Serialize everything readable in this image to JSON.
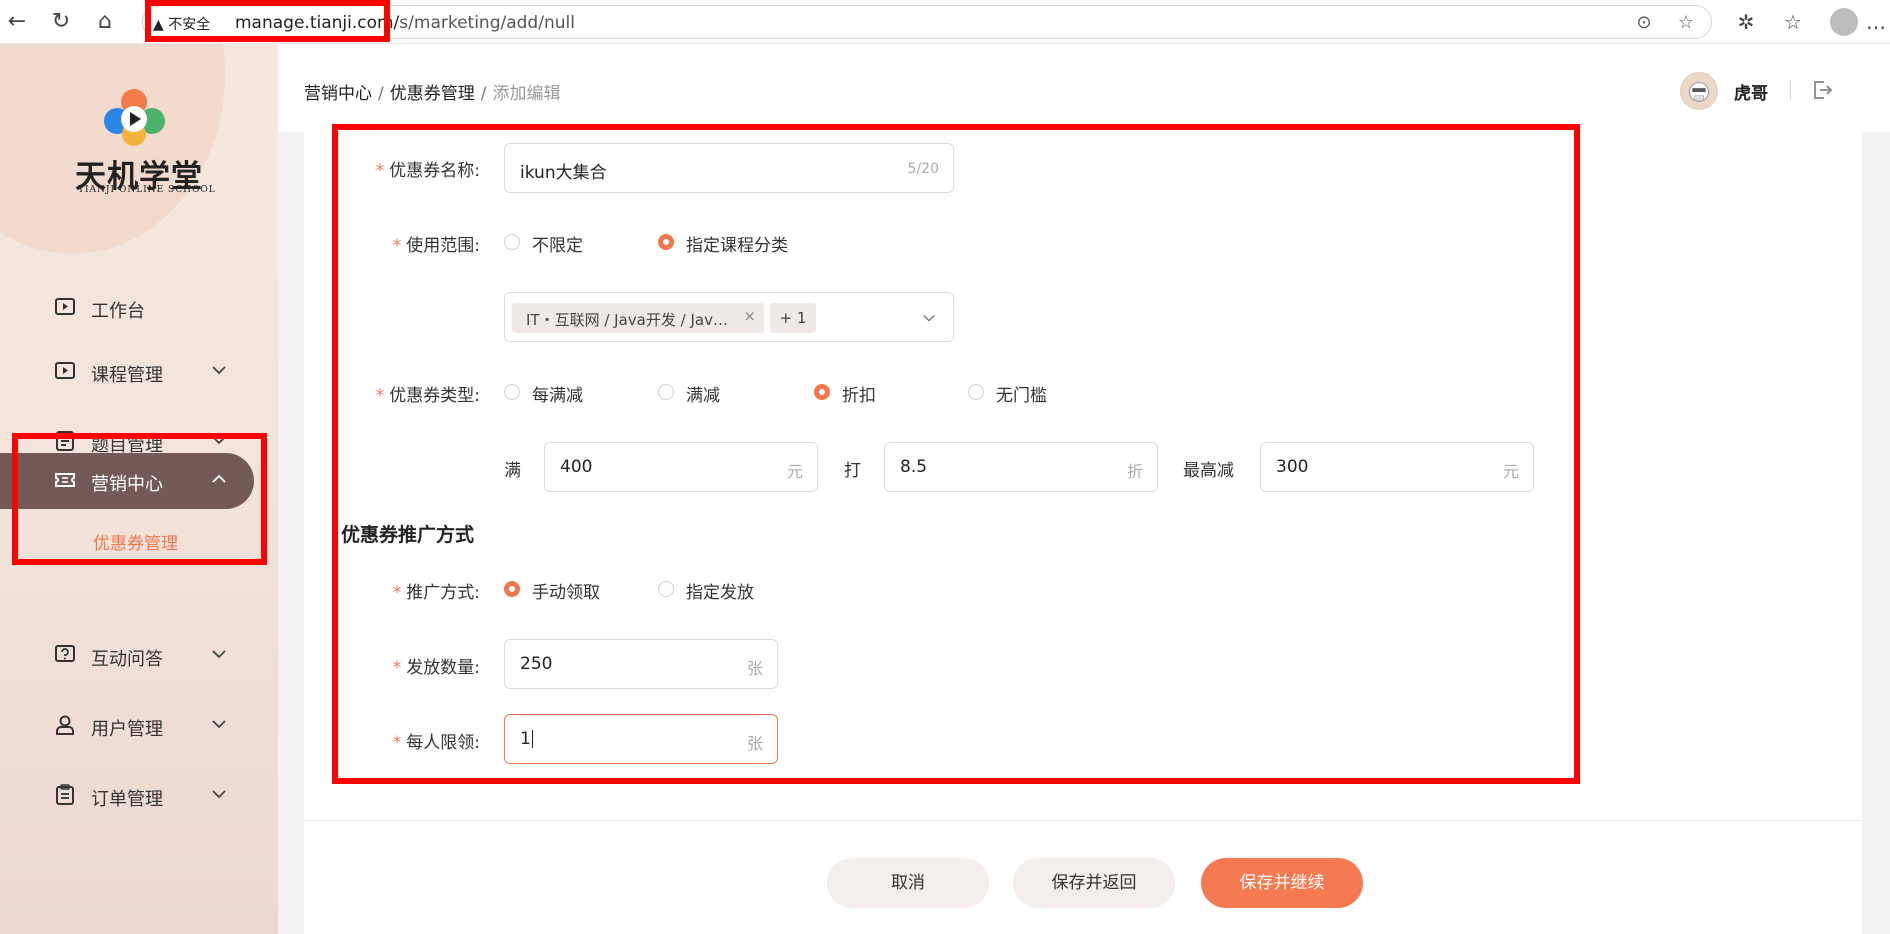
{
  "browser": {
    "warning": "不安全",
    "url_host": "manage.tianji.com/",
    "url_path": "s/marketing/add/null"
  },
  "sidebar": {
    "brand_title": "天机学堂",
    "brand_subtitle": "TIANJI ONLINE SCHOOL",
    "items": [
      {
        "label": "工作台",
        "icon": "play-square-icon"
      },
      {
        "label": "课程管理",
        "icon": "play-square-icon"
      },
      {
        "label": "题目管理",
        "icon": "list-doc-icon"
      },
      {
        "label": "营销中心",
        "icon": "ticket-icon"
      },
      {
        "label": "互动问答",
        "icon": "question-icon"
      },
      {
        "label": "用户管理",
        "icon": "user-icon"
      },
      {
        "label": "订单管理",
        "icon": "clipboard-icon"
      }
    ],
    "submenu_label": "优惠券管理"
  },
  "header": {
    "breadcrumb": [
      "营销中心",
      "优惠券管理",
      "添加编辑"
    ],
    "sep": "/",
    "user_name": "虎哥"
  },
  "form": {
    "name_label": "优惠券名称:",
    "name_value": "ikun大集合",
    "name_count": "5/20",
    "scope_label": "使用范围:",
    "scope_options": [
      "不限定",
      "指定课程分类"
    ],
    "scope_tag": "IT・互联网 / Java开发 / Jav…",
    "scope_tag_more": "+ 1",
    "type_label": "优惠券类型:",
    "type_options": [
      "每满减",
      "满减",
      "折扣",
      "无门槛"
    ],
    "full_label": "满",
    "full_value": "400",
    "full_unit": "元",
    "discount_label": "打",
    "discount_value": "8.5",
    "discount_unit": "折",
    "max_label": "最高减",
    "max_value": "300",
    "max_unit": "元",
    "promo_section": "优惠券推广方式",
    "promo_label": "推广方式:",
    "promo_options": [
      "手动领取",
      "指定发放"
    ],
    "qty_label": "发放数量:",
    "qty_value": "250",
    "qty_unit": "张",
    "limit_label": "每人限领:",
    "limit_value": "1",
    "limit_unit": "张"
  },
  "buttons": {
    "cancel": "取消",
    "save_return": "保存并返回",
    "save_continue": "保存并继续"
  },
  "colors": {
    "accent": "#f0764e",
    "active_menu": "#735a56",
    "highlight_box": "#ff0000"
  }
}
